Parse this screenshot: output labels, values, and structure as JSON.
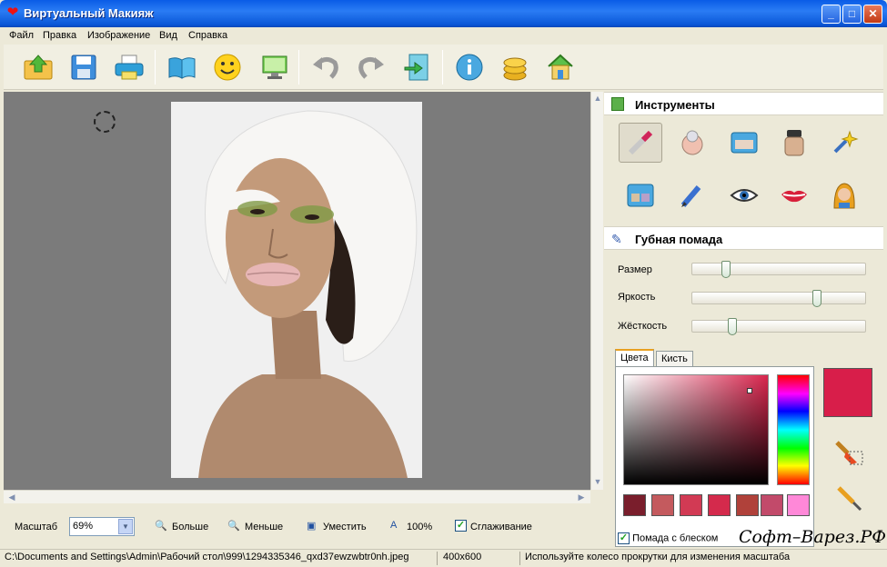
{
  "window": {
    "title": "Виртуальный Макияж",
    "icon": "heart-icon",
    "min": "_",
    "max": "□",
    "close": "✕"
  },
  "menu": [
    "Файл",
    "Правка",
    "Изображение",
    "Вид",
    "Справка"
  ],
  "toolbar": {
    "icons": [
      "open-folder-icon",
      "save-icon",
      "print-icon",
      "book-icon",
      "smiley-icon",
      "monitor-icon",
      "undo-icon",
      "redo-icon",
      "export-icon",
      "info-icon",
      "coins-icon",
      "home-icon"
    ]
  },
  "tools_panel": {
    "title": "Инструменты",
    "tools": [
      "lipstick-icon",
      "powder-icon",
      "compact-icon",
      "foundation-icon",
      "sparkle-icon",
      "eyeshadow-icon",
      "pencil-icon",
      "eye-icon",
      "lips-icon",
      "hair-icon"
    ]
  },
  "lipstick_panel": {
    "title": "Губная помада",
    "sliders": [
      {
        "label": "Размер",
        "value": 0.18
      },
      {
        "label": "Яркость",
        "value": 0.74
      },
      {
        "label": "Жёсткость",
        "value": 0.22
      }
    ],
    "tabs": [
      "Цвета",
      "Кисть"
    ],
    "swatches": [
      "#7A1E2C",
      "#C45A5E",
      "#D23A54",
      "#D42A4C",
      "#B0413A",
      "#C24A6A",
      "#FF88D8"
    ],
    "current_color": "#D81E4A",
    "gloss_checkbox": "Помада с блеском"
  },
  "bottom": {
    "scale_label": "Масштаб",
    "scale_value": "69%",
    "zoom_in": "Больше",
    "zoom_out": "Меньше",
    "fit": "Уместить",
    "actual": "100%",
    "smoothing": "Сглаживание"
  },
  "status": {
    "path": "C:\\Documents and Settings\\Admin\\Рабочий стол\\999\\1294335346_qxd37ewzwbtr0nh.jpeg",
    "size": "400x600",
    "hint": "Используйте колесо прокрутки для изменения масштаба"
  },
  "watermark": "Софт–Варез.РФ"
}
